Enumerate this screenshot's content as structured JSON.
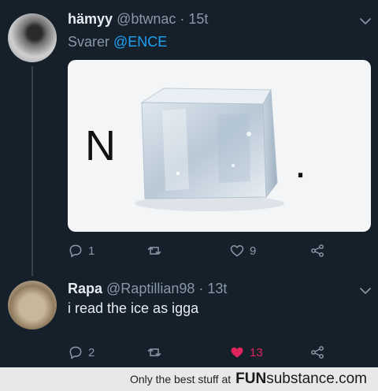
{
  "tweet": {
    "display_name": "hämyy",
    "handle": "@btwnac",
    "time": " · 15t",
    "reply_prefix": "Svarer ",
    "reply_mention": "@ENCE",
    "image_text_left": "N",
    "image_text_right": ".",
    "reply_count": "1",
    "retweet_count": "",
    "like_count": "9"
  },
  "reply": {
    "display_name": "Rapa",
    "handle": "@Raptillian98",
    "time": " · 13t",
    "text": "i read the ice as igga",
    "reply_count": "2",
    "retweet_count": "",
    "like_count": "13",
    "like_color": "#e0245e"
  },
  "footer": {
    "tagline": "Only the best stuff at",
    "brand_bold": "FUN",
    "brand_regular": "substance.com"
  },
  "colors": {
    "background": "#15202b",
    "accent": "#1da1f2",
    "muted": "#8899a6"
  }
}
